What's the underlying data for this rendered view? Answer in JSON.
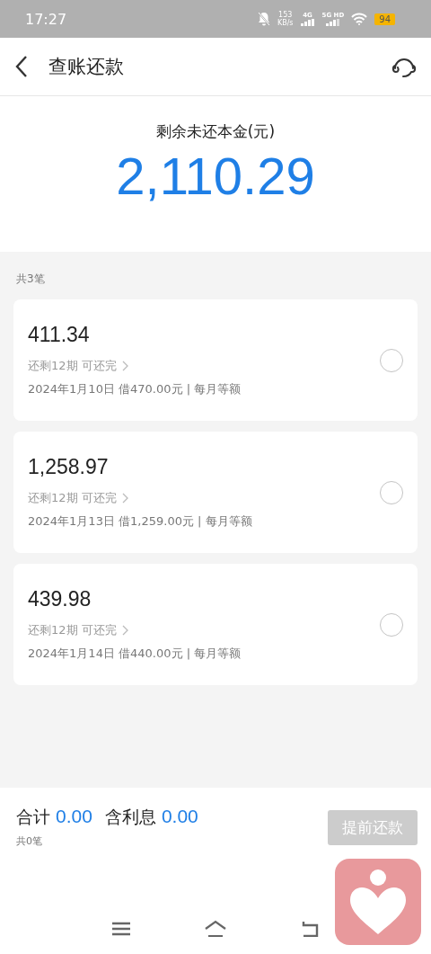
{
  "status_bar": {
    "time": "17:27",
    "speed": "153",
    "speed_unit": "KB/s",
    "network_1": "4G",
    "network_2": "5G HD",
    "battery": "94"
  },
  "header": {
    "title": "查账还款"
  },
  "summary": {
    "label": "剩余未还本金(元)",
    "amount": "2,110.29"
  },
  "list": {
    "count": "共3笔",
    "loans": [
      {
        "amount": "411.34",
        "term": "还剩12期 可还完",
        "detail": "2024年1月10日 借470.00元 | 每月等额",
        "selected": false
      },
      {
        "amount": "1,258.97",
        "term": "还剩12期 可还完",
        "detail": "2024年1月13日 借1,259.00元 | 每月等额",
        "selected": false
      },
      {
        "amount": "439.98",
        "term": "还剩12期 可还完",
        "detail": "2024年1月14日 借440.00元 | 每月等额",
        "selected": false
      }
    ]
  },
  "footer": {
    "total_label": "合计",
    "total": "0.00",
    "interest_label": "含利息",
    "interest": "0.00",
    "count": "共0笔",
    "button": {
      "label": "提前还款",
      "disabled": true
    }
  }
}
